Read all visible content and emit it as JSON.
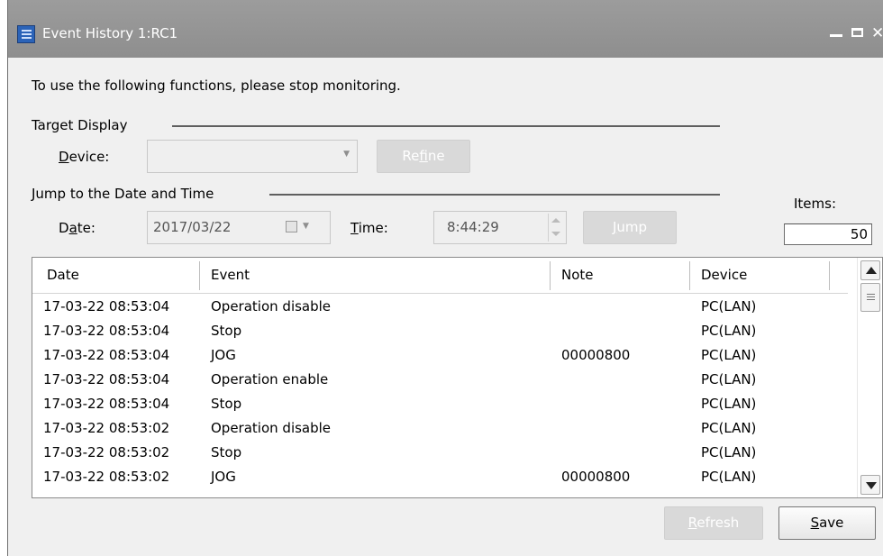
{
  "window": {
    "title": "Event History 1:RC1"
  },
  "notice": "To use the following functions, please stop monitoring.",
  "target_display": {
    "section_label": "Target Display",
    "device_label_pre": "",
    "device_label_u": "D",
    "device_label_post": "evice:",
    "device_value": "",
    "refine_pre": "Re",
    "refine_u": "f",
    "refine_post": "ine"
  },
  "jump": {
    "section_label": "Jump to the Date and Time",
    "date_label_pre": "D",
    "date_label_u": "a",
    "date_label_post": "te:",
    "date_value": "2017/03/22",
    "time_label_pre": "",
    "time_label_u": "T",
    "time_label_post": "ime:",
    "time_value": "8:44:29",
    "jump_pre": "",
    "jump_u": "J",
    "jump_post": "ump"
  },
  "items": {
    "label": "Items:",
    "value": "50"
  },
  "table": {
    "columns": [
      "Date",
      "Event",
      "Note",
      "Device"
    ],
    "rows": [
      [
        "17-03-22 08:53:04",
        "Operation disable",
        "",
        "PC(LAN)"
      ],
      [
        "17-03-22 08:53:04",
        "Stop",
        "",
        "PC(LAN)"
      ],
      [
        "17-03-22 08:53:04",
        "JOG",
        "00000800",
        "PC(LAN)"
      ],
      [
        "17-03-22 08:53:04",
        "Operation enable",
        "",
        "PC(LAN)"
      ],
      [
        "17-03-22 08:53:04",
        "Stop",
        "",
        "PC(LAN)"
      ],
      [
        "17-03-22 08:53:02",
        "Operation disable",
        "",
        "PC(LAN)"
      ],
      [
        "17-03-22 08:53:02",
        "Stop",
        "",
        "PC(LAN)"
      ],
      [
        "17-03-22 08:53:02",
        "JOG",
        "00000800",
        "PC(LAN)"
      ]
    ]
  },
  "footer": {
    "refresh_pre": "",
    "refresh_u": "R",
    "refresh_post": "efresh",
    "save_pre": "",
    "save_u": "S",
    "save_post": "ave"
  }
}
